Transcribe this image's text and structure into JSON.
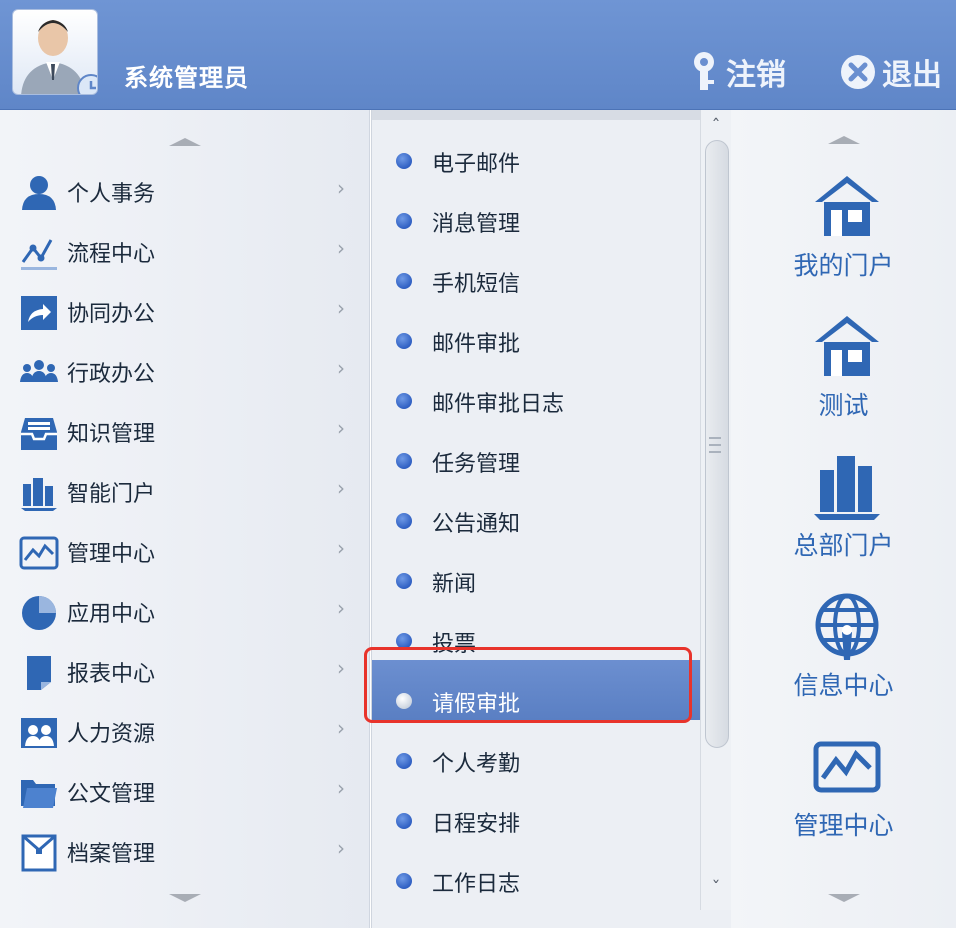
{
  "header": {
    "user_name": "系统管理员",
    "logout_label": "注销",
    "exit_label": "退出"
  },
  "left_menu": {
    "items": [
      {
        "label": "个人事务",
        "icon": "person-icon"
      },
      {
        "label": "流程中心",
        "icon": "flow-icon"
      },
      {
        "label": "协同办公",
        "icon": "share-icon"
      },
      {
        "label": "行政办公",
        "icon": "group-icon"
      },
      {
        "label": "知识管理",
        "icon": "inbox-icon"
      },
      {
        "label": "智能门户",
        "icon": "buildings-icon"
      },
      {
        "label": "管理中心",
        "icon": "chart-icon"
      },
      {
        "label": "应用中心",
        "icon": "pie-icon"
      },
      {
        "label": "报表中心",
        "icon": "report-icon"
      },
      {
        "label": "人力资源",
        "icon": "people-icon"
      },
      {
        "label": "公文管理",
        "icon": "folder-icon"
      },
      {
        "label": "档案管理",
        "icon": "archive-icon"
      }
    ]
  },
  "sub_menu": {
    "selected": "请假审批",
    "items": [
      {
        "label": "电子邮件"
      },
      {
        "label": "消息管理"
      },
      {
        "label": "手机短信"
      },
      {
        "label": "邮件审批"
      },
      {
        "label": "邮件审批日志"
      },
      {
        "label": "任务管理"
      },
      {
        "label": "公告通知"
      },
      {
        "label": "新闻"
      },
      {
        "label": "投票"
      },
      {
        "label": "请假审批"
      },
      {
        "label": "个人考勤"
      },
      {
        "label": "日程安排"
      },
      {
        "label": "工作日志"
      }
    ]
  },
  "portals": {
    "items": [
      {
        "label": "我的门户",
        "icon": "home-icon"
      },
      {
        "label": "测试",
        "icon": "home-icon"
      },
      {
        "label": "总部门户",
        "icon": "buildings-icon"
      },
      {
        "label": "信息中心",
        "icon": "globe-icon"
      },
      {
        "label": "管理中心",
        "icon": "chart-icon"
      }
    ]
  },
  "colors": {
    "header_bg": "#6a8fd0",
    "active_bg": "#6386c9",
    "highlight_border": "#e8332b",
    "portal_text": "#2f67b4",
    "icon_blue": "#2f67b4"
  }
}
